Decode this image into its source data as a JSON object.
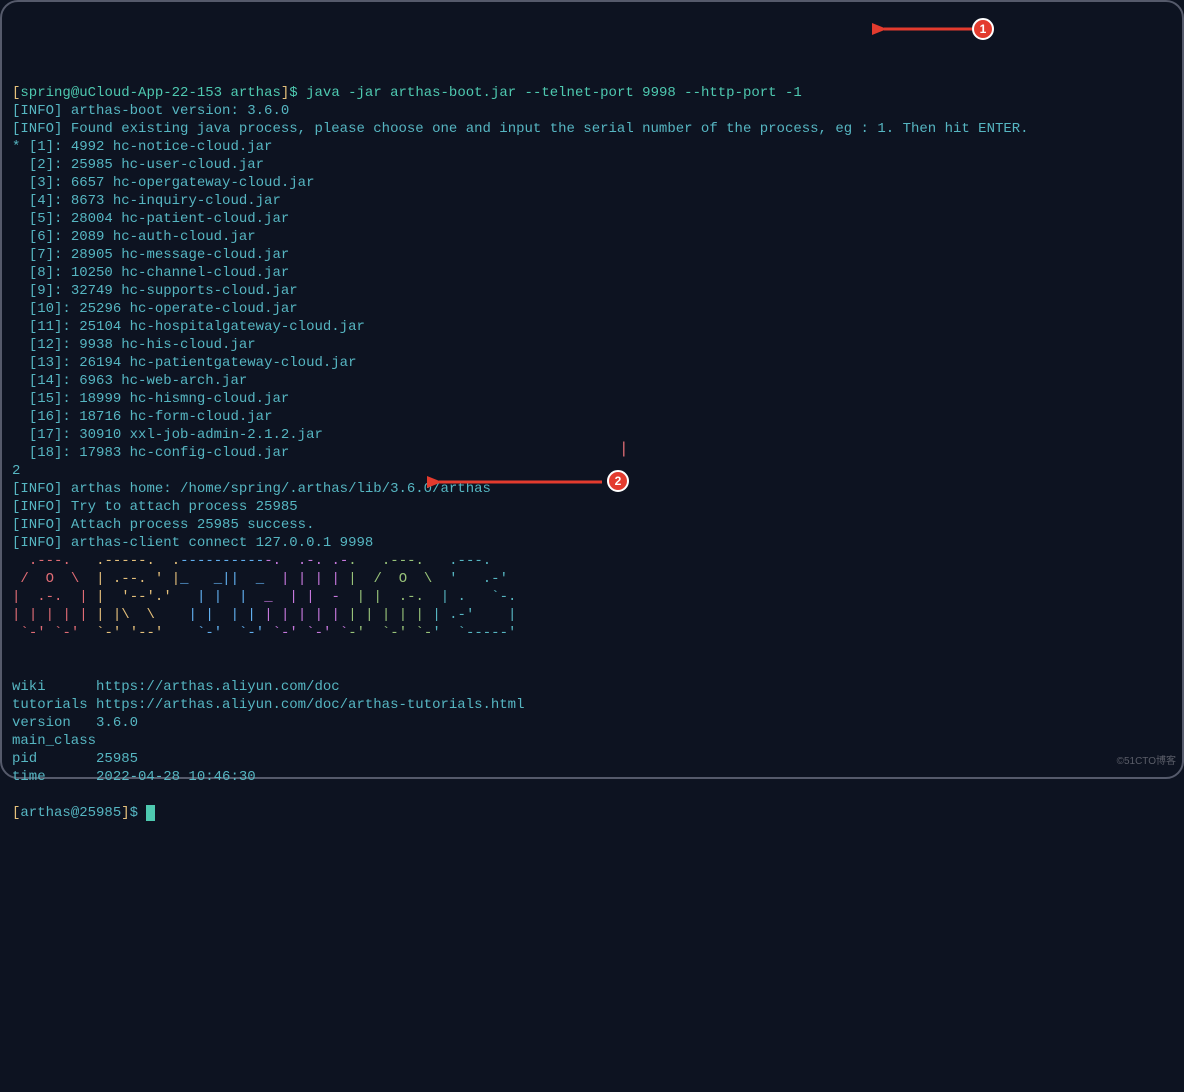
{
  "prompt": {
    "user": "spring",
    "host": "uCloud-App-22-153",
    "cwd": "arthas",
    "command": "java -jar arthas-boot.jar --telnet-port 9998 --http-port -1"
  },
  "boot_info": {
    "version_line": "arthas-boot version: 3.6.0",
    "choose_line": "Found existing java process, please choose one and input the serial number of the process, eg : 1. Then hit ENTER."
  },
  "processes": [
    {
      "idx": "[1]",
      "pid": "4992",
      "name": "hc-notice-cloud.jar",
      "star": "*"
    },
    {
      "idx": "[2]",
      "pid": "25985",
      "name": "hc-user-cloud.jar",
      "star": " "
    },
    {
      "idx": "[3]",
      "pid": "6657",
      "name": "hc-opergateway-cloud.jar",
      "star": " "
    },
    {
      "idx": "[4]",
      "pid": "8673",
      "name": "hc-inquiry-cloud.jar",
      "star": " "
    },
    {
      "idx": "[5]",
      "pid": "28004",
      "name": "hc-patient-cloud.jar",
      "star": " "
    },
    {
      "idx": "[6]",
      "pid": "2089",
      "name": "hc-auth-cloud.jar",
      "star": " "
    },
    {
      "idx": "[7]",
      "pid": "28905",
      "name": "hc-message-cloud.jar",
      "star": " "
    },
    {
      "idx": "[8]",
      "pid": "10250",
      "name": "hc-channel-cloud.jar",
      "star": " "
    },
    {
      "idx": "[9]",
      "pid": "32749",
      "name": "hc-supports-cloud.jar",
      "star": " "
    },
    {
      "idx": "[10]",
      "pid": "25296",
      "name": "hc-operate-cloud.jar",
      "star": " "
    },
    {
      "idx": "[11]",
      "pid": "25104",
      "name": "hc-hospitalgateway-cloud.jar",
      "star": " "
    },
    {
      "idx": "[12]",
      "pid": "9938",
      "name": "hc-his-cloud.jar",
      "star": " "
    },
    {
      "idx": "[13]",
      "pid": "26194",
      "name": "hc-patientgateway-cloud.jar",
      "star": " "
    },
    {
      "idx": "[14]",
      "pid": "6963",
      "name": "hc-web-arch.jar",
      "star": " "
    },
    {
      "idx": "[15]",
      "pid": "18999",
      "name": "hc-hismng-cloud.jar",
      "star": " "
    },
    {
      "idx": "[16]",
      "pid": "18716",
      "name": "hc-form-cloud.jar",
      "star": " "
    },
    {
      "idx": "[17]",
      "pid": "30910",
      "name": "xxl-job-admin-2.1.2.jar",
      "star": " "
    },
    {
      "idx": "[18]",
      "pid": "17983",
      "name": "hc-config-cloud.jar",
      "star": " "
    }
  ],
  "user_input": "2",
  "attach_info": {
    "home": "arthas home: /home/spring/.arthas/lib/3.6.0/arthas",
    "try": "Try to attach process 25985",
    "success": "Attach process 25985 success.",
    "connect": "arthas-client connect 127.0.0.1 9998"
  },
  "ascii": {
    "l1": "  .---.   .-----.  .-----------.  .-. .-.   .---.   .---.  ",
    "l2": " /  O  \\  | .--. ' |_   _||  _  | | | | |  /  O  \\  '   .-' ",
    "l3": "|  .-.  | |  '--'.'   | |  |  _  | |  -  | |  .-.  | .   `-. ",
    "l4": "| | | | | | |\\  \\    | |  | | | | | | | | | | | | | .-'    |",
    "l5": " `-' `-'  `-' '--'    `-'  `-' `-' `-' `-'  `-' `-'  `-----' "
  },
  "footer": {
    "wiki_label": "wiki      ",
    "wiki_url": "https://arthas.aliyun.com/doc",
    "tutorials_label": "tutorials ",
    "tutorials_url": "https://arthas.aliyun.com/doc/arthas-tutorials.html",
    "version_label": "version   ",
    "version_val": "3.6.0",
    "main_class_label": "main_class",
    "main_class_val": "",
    "pid_label": "pid       ",
    "pid_val": "25985",
    "time_label": "time      ",
    "time_val": "2022-04-28 10:46:30"
  },
  "final_prompt": {
    "text": "arthas@25985"
  },
  "badges": {
    "b1": "1",
    "b2": "2"
  },
  "watermark": "©51CTO博客"
}
